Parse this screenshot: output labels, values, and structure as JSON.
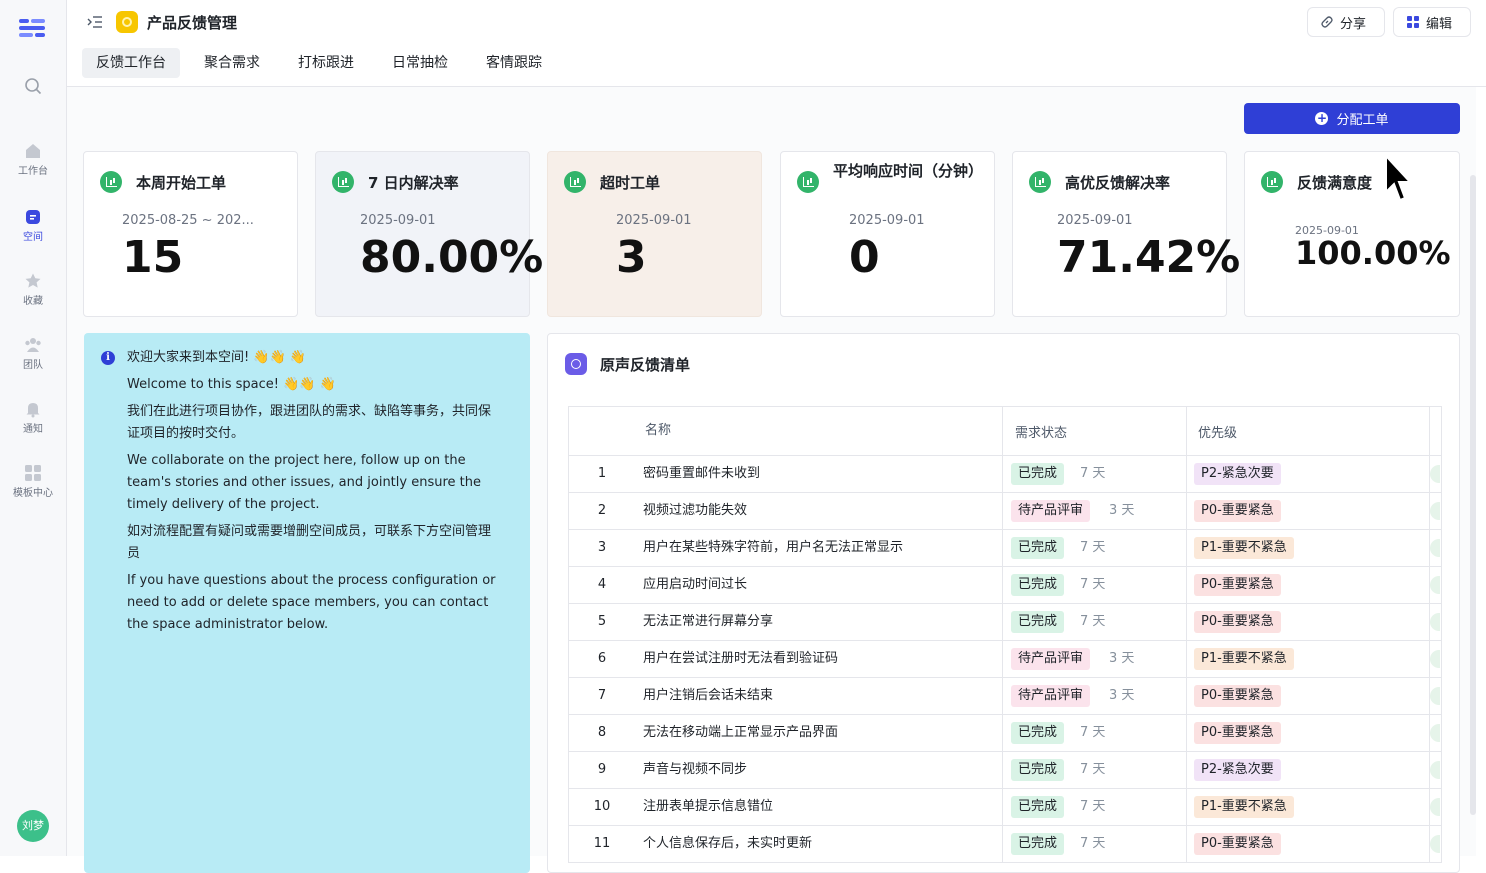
{
  "header": {
    "title": "产品反馈管理",
    "share_label": "分享",
    "edit_label": "编辑"
  },
  "rail": {
    "items": [
      {
        "label": "工作台",
        "icon": "home-icon"
      },
      {
        "label": "空间",
        "icon": "space-icon",
        "active": true
      },
      {
        "label": "收藏",
        "icon": "star-icon"
      },
      {
        "label": "团队",
        "icon": "team-icon"
      },
      {
        "label": "通知",
        "icon": "bell-icon"
      },
      {
        "label": "模板中心",
        "icon": "template-icon"
      }
    ],
    "avatar_text": "刘梦"
  },
  "tabs": [
    "反馈工作台",
    "聚合需求",
    "打标跟进",
    "日常抽检",
    "客情跟踪"
  ],
  "assign_button": "分配工单",
  "cards": [
    {
      "title": "本周开始工单",
      "date": "2025-08-25 ~ 202...",
      "value": "15"
    },
    {
      "title": "7 日内解决率",
      "date": "2025-09-01",
      "value": "80.00%"
    },
    {
      "title": "超时工单",
      "date": "2025-09-01",
      "value": "3"
    },
    {
      "title": "平均响应时间（分钟）",
      "date": "2025-09-01",
      "value": "0"
    },
    {
      "title": "高优反馈解决率",
      "date": "2025-09-01",
      "value": "71.42%"
    },
    {
      "title": "反馈满意度",
      "date": "2025-09-01",
      "value": "100.00%"
    }
  ],
  "welcome": {
    "line1": "欢迎大家来到本空间! 👋👋 👋",
    "line2": "Welcome to this space! 👋👋 👋",
    "line3": "我们在此进行项目协作，跟进团队的需求、缺陷等事务，共同保证项目的按时交付。",
    "line4": "We collaborate on the project here, follow up on the team's stories and other issues, and jointly ensure the timely delivery of the project.",
    "line5": "如对流程配置有疑问或需要增删空间成员，可联系下方空间管理员",
    "line6": "If you have questions about the process configuration or need to add or delete space members, you can contact the space administrator below."
  },
  "list": {
    "title": "原声反馈清单",
    "columns": {
      "name": "名称",
      "status": "需求状态",
      "priority": "优先级"
    },
    "rows": [
      {
        "idx": "1",
        "name": "密码重置邮件未收到",
        "status": "已完成",
        "days": "7 天",
        "priority": "P2-紧急次要"
      },
      {
        "idx": "2",
        "name": "视频过滤功能失效",
        "status": "待产品评审",
        "days": "3 天",
        "priority": "P0-重要紧急"
      },
      {
        "idx": "3",
        "name": "用户在某些特殊字符前，用户名无法正常显示",
        "status": "已完成",
        "days": "7 天",
        "priority": "P1-重要不紧急"
      },
      {
        "idx": "4",
        "name": "应用启动时间过长",
        "status": "已完成",
        "days": "7 天",
        "priority": "P0-重要紧急"
      },
      {
        "idx": "5",
        "name": "无法正常进行屏幕分享",
        "status": "已完成",
        "days": "7 天",
        "priority": "P0-重要紧急"
      },
      {
        "idx": "6",
        "name": "用户在尝试注册时无法看到验证码",
        "status": "待产品评审",
        "days": "3 天",
        "priority": "P1-重要不紧急"
      },
      {
        "idx": "7",
        "name": "用户注销后会话未结束",
        "status": "待产品评审",
        "days": "3 天",
        "priority": "P0-重要紧急"
      },
      {
        "idx": "8",
        "name": "无法在移动端上正常显示产品界面",
        "status": "已完成",
        "days": "7 天",
        "priority": "P0-重要紧急"
      },
      {
        "idx": "9",
        "name": "声音与视频不同步",
        "status": "已完成",
        "days": "7 天",
        "priority": "P2-紧急次要"
      },
      {
        "idx": "10",
        "name": "注册表单提示信息错位",
        "status": "已完成",
        "days": "7 天",
        "priority": "P1-重要不紧急"
      },
      {
        "idx": "11",
        "name": "个人信息保存后，未实时更新",
        "status": "已完成",
        "days": "7 天",
        "priority": "P0-重要紧急"
      }
    ]
  }
}
